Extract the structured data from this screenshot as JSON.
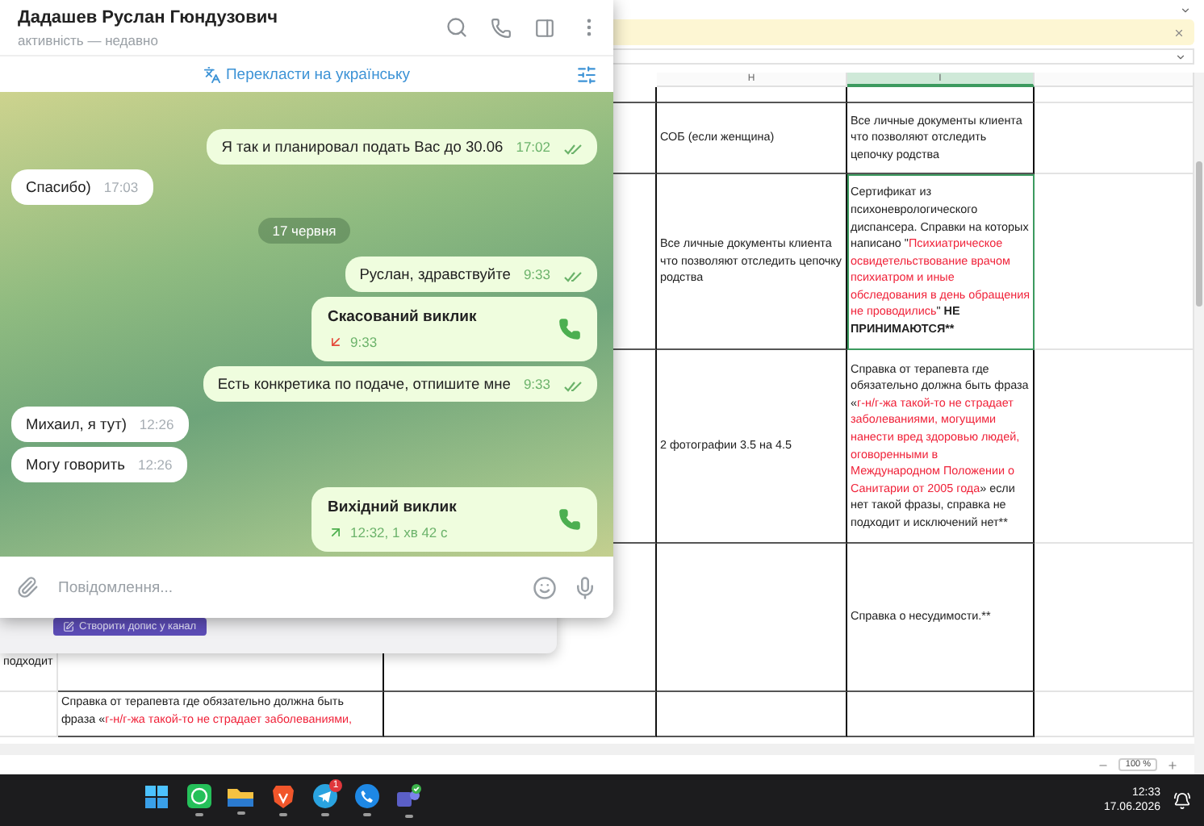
{
  "telegram": {
    "contact_name": "Дадашев Руслан Гюндузович",
    "status": "активність — недавно",
    "translate_label": "Перекласти на українську",
    "messages": [
      {
        "kind": "outgoing",
        "text": "Я так и планировал подать Вас до 30.06",
        "time": "17:02",
        "read": true
      },
      {
        "kind": "incoming",
        "text": "Спасибо)",
        "time": "17:03"
      },
      {
        "kind": "date",
        "text": "17 червня"
      },
      {
        "kind": "outgoing",
        "text": "Руслан, здравствуйте",
        "time": "9:33",
        "read": true
      },
      {
        "kind": "call",
        "title": "Скасований виклик",
        "detail": "9:33",
        "missed": true
      },
      {
        "kind": "outgoing",
        "text": "Есть конкретика по подаче, отпишите мне",
        "time": "9:33",
        "read": true
      },
      {
        "kind": "incoming",
        "text": "Михаил, я тут)",
        "time": "12:26"
      },
      {
        "kind": "incoming",
        "text": "Могу говорить",
        "time": "12:26"
      },
      {
        "kind": "call",
        "title": "Вихідний виклик",
        "detail": "12:32, 1 хв 42 с",
        "missed": false
      }
    ],
    "composer": {
      "placeholder": "Повідомлення..."
    }
  },
  "channel_panel": {
    "button": "Створити допис у канал"
  },
  "spreadsheet": {
    "columns": [
      {
        "label": "H",
        "selected": false
      },
      {
        "label": "I",
        "selected": true
      }
    ],
    "rows": [
      {
        "column_h": {
          "selected": false,
          "segments": [
            {
              "kind": "normal",
              "text": "СОБ (если женщина)"
            }
          ]
        },
        "column_i": {
          "selected": false,
          "segments": [
            {
              "kind": "normal",
              "text": "Все личные документы клиента что позволяют отследить цепочку родства"
            }
          ]
        }
      },
      {
        "column_h": {
          "selected": false,
          "segments": [
            {
              "kind": "normal",
              "text": "Все личные документы клиента что позволяют отследить цепочку родства"
            }
          ]
        },
        "column_i": {
          "selected": true,
          "segments": [
            {
              "kind": "normal",
              "text": "Сертификат из психоневрологического диспансера. Справки на которых написано \""
            },
            {
              "kind": "warning",
              "text": "Психиатрическое освидетельствование врачом психиатром и иные обследования в день обращения не проводились"
            },
            {
              "kind": "normal",
              "text": "\" "
            },
            {
              "kind": "bold",
              "text": "НЕ ПРИНИМАЮТСЯ**"
            }
          ]
        }
      },
      {
        "column_h": {
          "selected": false,
          "segments": [
            {
              "kind": "normal",
              "text": "2 фотографии 3.5 на 4.5"
            }
          ]
        },
        "column_i": {
          "selected": false,
          "segments": [
            {
              "kind": "normal",
              "text": "Справка от терапевта где обязательно должна быть фраза «"
            },
            {
              "kind": "warning",
              "text": "г-н/г-жа такой-то не страдает заболеваниями, могущими нанести вред здоровью людей, оговоренными в Международном Положении о Санитарии от 2005 года"
            },
            {
              "kind": "normal",
              "text": "» если нет такой фразы, справка не подходит и исключений нет**"
            }
          ]
        }
      },
      {
        "column_1": {
          "selected": false,
          "segments": [
            {
              "kind": "normal",
              "text": "подходит"
            }
          ]
        },
        "column_i": {
          "selected": false,
          "segments": [
            {
              "kind": "normal",
              "text": "Справка о несудимости.**"
            }
          ]
        }
      },
      {
        "column_2": {
          "selected": false,
          "segments": [
            {
              "kind": "normal",
              "text": "Справка от терапевта где обязательно должна быть фраза «"
            },
            {
              "kind": "warning",
              "text": "г-н/г-жа такой-то не страдает заболеваниями,"
            }
          ]
        }
      }
    ],
    "zoom": "100 %"
  },
  "taskbar": {
    "apps": [
      {
        "kind": "start",
        "running": false
      },
      {
        "kind": "whatsapp",
        "running": true
      },
      {
        "kind": "folder",
        "running": true
      },
      {
        "kind": "brave",
        "running": true
      },
      {
        "kind": "telegram",
        "running": true,
        "badge": "1"
      },
      {
        "kind": "phone",
        "running": true
      },
      {
        "kind": "teams",
        "running": true
      }
    ],
    "time": "12:33",
    "date": "17.06.2026"
  }
}
